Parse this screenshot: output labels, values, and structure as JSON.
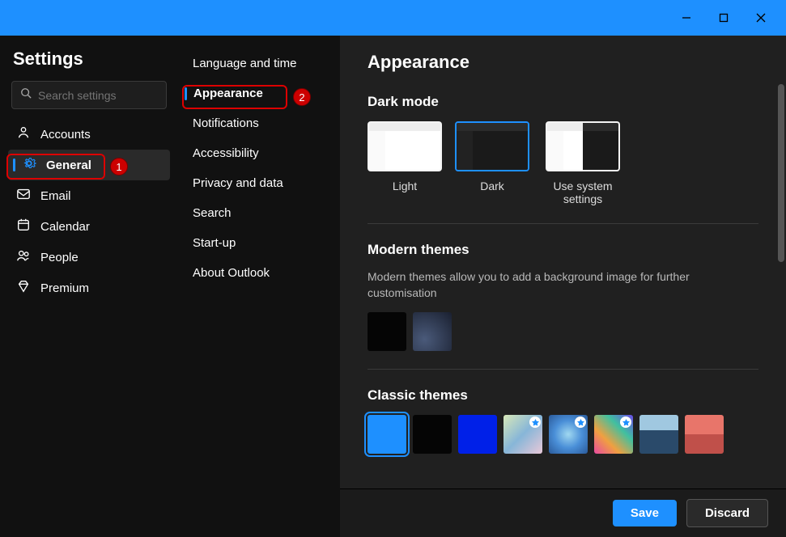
{
  "window": {
    "minimize": "–",
    "maximize": "□",
    "close": "✕"
  },
  "settings_title": "Settings",
  "search_placeholder": "Search settings",
  "nav": [
    {
      "key": "accounts",
      "label": "Accounts",
      "icon": "person",
      "active": false
    },
    {
      "key": "general",
      "label": "General",
      "icon": "gear",
      "active": true
    },
    {
      "key": "email",
      "label": "Email",
      "icon": "mail",
      "active": false
    },
    {
      "key": "calendar",
      "label": "Calendar",
      "icon": "calendar",
      "active": false
    },
    {
      "key": "people",
      "label": "People",
      "icon": "people",
      "active": false
    },
    {
      "key": "premium",
      "label": "Premium",
      "icon": "diamond",
      "active": false
    }
  ],
  "subnav": [
    {
      "key": "lang",
      "label": "Language and time",
      "active": false
    },
    {
      "key": "appearance",
      "label": "Appearance",
      "active": true
    },
    {
      "key": "notifications",
      "label": "Notifications",
      "active": false
    },
    {
      "key": "accessibility",
      "label": "Accessibility",
      "active": false
    },
    {
      "key": "privacy",
      "label": "Privacy and data",
      "active": false
    },
    {
      "key": "search",
      "label": "Search",
      "active": false
    },
    {
      "key": "startup",
      "label": "Start-up",
      "active": false
    },
    {
      "key": "about",
      "label": "About Outlook",
      "active": false
    }
  ],
  "page": {
    "title": "Appearance",
    "dark_mode": {
      "heading": "Dark mode",
      "options": [
        {
          "key": "light",
          "label": "Light",
          "selected": false
        },
        {
          "key": "dark",
          "label": "Dark",
          "selected": true
        },
        {
          "key": "system",
          "label": "Use system settings",
          "selected": false
        }
      ]
    },
    "modern_themes": {
      "heading": "Modern themes",
      "description": "Modern themes allow you to add a background image for further customisation",
      "swatches": [
        {
          "color": "#050505",
          "selected": false
        },
        {
          "color": "#2a3a52",
          "selected": false,
          "gradient": true
        }
      ]
    },
    "classic_themes": {
      "heading": "Classic themes",
      "swatches": [
        {
          "color": "#1e90ff",
          "selected": true,
          "star": false
        },
        {
          "color": "#050505",
          "selected": false,
          "star": false
        },
        {
          "color": "#0020e8",
          "selected": false,
          "star": false
        },
        {
          "color": "#87b6d8",
          "selected": false,
          "star": true,
          "image": "pastel"
        },
        {
          "color": "#4a8fd8",
          "selected": false,
          "star": true,
          "image": "swirl"
        },
        {
          "color": "#e84aa0",
          "selected": false,
          "star": true,
          "image": "ribbons"
        },
        {
          "color": "#4a6a8a",
          "selected": false,
          "star": false,
          "image": "mountain"
        },
        {
          "color": "#e8756a",
          "selected": false,
          "star": false,
          "image": "sunset"
        }
      ]
    }
  },
  "footer": {
    "save": "Save",
    "discard": "Discard"
  },
  "annotations": {
    "1": "1",
    "2": "2"
  }
}
